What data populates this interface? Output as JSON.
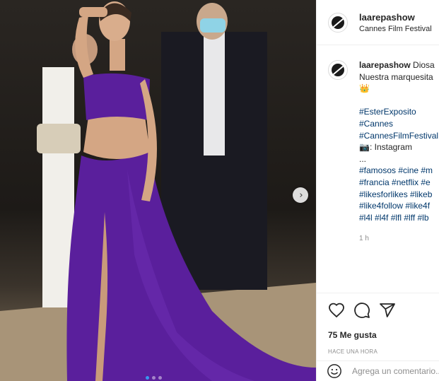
{
  "header": {
    "username": "laarepashow",
    "location": "Cannes Film Festival",
    "avatar_icon": "vinyl-record-icon"
  },
  "caption": {
    "username": "laarepashow",
    "lines": [
      "Diosa",
      "Nuestra marquesita"
    ],
    "crown": "👑",
    "hashtags_block1": [
      "#EsterExposito",
      "#Cannes",
      "#CannesFilmFestival"
    ],
    "camera": "📷",
    "source_text": ": Instagram",
    "ellipsis": "...",
    "tag_lines": [
      "#famosos #cine #m",
      "#francia #netflix #e",
      "#likesforlikes #likeb",
      "#like4follow #like4f",
      "#l4l #l4f #lfl #lff #lb"
    ],
    "time_ago": "1 h"
  },
  "actions": {
    "like_icon": "heart-icon",
    "comment_icon": "comment-bubble-icon",
    "share_icon": "paper-plane-icon",
    "likes_text": "75 Me gusta",
    "timestamp": "HACE UNA HORA"
  },
  "comment": {
    "placeholder": "Agrega un comentario...",
    "emoji_icon": "smiley-icon"
  },
  "carousel": {
    "next_glyph": "›",
    "slide_count": 3,
    "active_slide": 1
  },
  "colors": {
    "dress": "#5a1f9c",
    "link": "#00376b",
    "muted": "#8e8e8e",
    "carousel_active": "#3897f0"
  }
}
